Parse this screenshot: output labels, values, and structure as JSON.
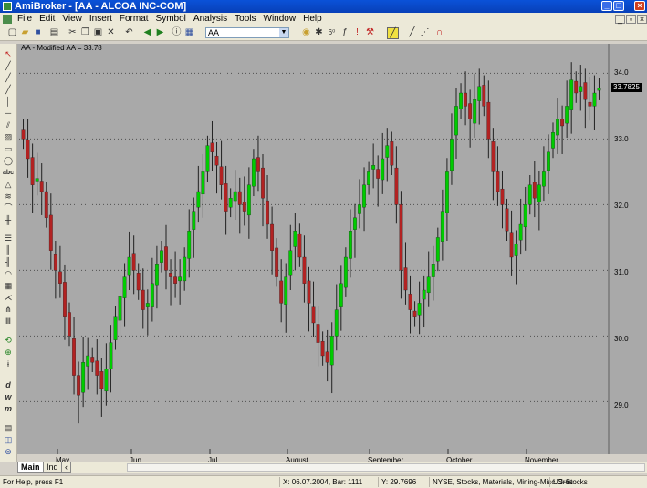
{
  "window": {
    "title": "AmiBroker - [AA - ALCOA INC-COM]"
  },
  "menu": {
    "items": [
      "File",
      "Edit",
      "View",
      "Insert",
      "Format",
      "Symbol",
      "Analysis",
      "Tools",
      "Window",
      "Help"
    ]
  },
  "toolbar": {
    "symbol_value": "AA"
  },
  "chart": {
    "header": "AA - Modified AA = 33.78",
    "last_price_label": "33.7825"
  },
  "chart_data": {
    "type": "candlestick",
    "title": "AA - Modified AA = 33.78",
    "ylim": [
      28.2,
      34.45
    ],
    "y_ticks": [
      "34.0",
      "33.0",
      "32.0",
      "31.0",
      "30.0",
      "29.0"
    ],
    "x_ticks": [
      "May",
      "Jun",
      "Jul",
      "August",
      "September",
      "October",
      "November"
    ],
    "grid": true,
    "up_color": "#00cc00",
    "down_color": "#b22222",
    "last_value": 33.7825,
    "closes": [
      33.0,
      32.7,
      32.3,
      32.4,
      32.2,
      31.8,
      31.3,
      31.0,
      30.8,
      30.3,
      30.0,
      29.4,
      29.1,
      29.6,
      29.7,
      29.6,
      29.4,
      29.2,
      29.5,
      29.9,
      30.3,
      30.6,
      30.9,
      31.2,
      31.0,
      30.7,
      30.4,
      30.5,
      30.8,
      31.1,
      31.3,
      31.0,
      30.9,
      30.8,
      30.9,
      31.2,
      31.6,
      31.9,
      32.2,
      32.5,
      32.9,
      32.8,
      32.6,
      32.3,
      31.9,
      32.1,
      32.2,
      32.0,
      31.9,
      32.3,
      32.7,
      32.5,
      32.1,
      31.7,
      31.3,
      30.9,
      30.5,
      30.9,
      31.3,
      31.6,
      31.2,
      30.8,
      30.5,
      30.2,
      29.9,
      29.7,
      29.6,
      30.0,
      30.4,
      30.8,
      31.2,
      31.6,
      31.8,
      32.0,
      32.3,
      32.5,
      32.6,
      32.4,
      32.7,
      32.9,
      32.6,
      32.0,
      31.0,
      30.7,
      30.4,
      30.3,
      30.5,
      30.7,
      30.9,
      31.1,
      31.5,
      31.9,
      32.5,
      33.0,
      33.5,
      33.7,
      33.5,
      33.3,
      33.6,
      33.8,
      33.5,
      33.0,
      32.5,
      32.2,
      32.0,
      31.6,
      31.2,
      31.4,
      31.7,
      32.0,
      32.3,
      32.1,
      32.3,
      32.5,
      32.8,
      33.1,
      33.3,
      33.2,
      33.5,
      33.9,
      33.7,
      33.8,
      33.6,
      33.5,
      33.7,
      33.78
    ]
  },
  "tabs": [
    "Main",
    "Ind"
  ],
  "status": {
    "help": "For Help, press F1",
    "xinfo": "X: 06.07.2004, Bar: 1111",
    "yinfo": "Y: 29.7696",
    "market": "NYSE, Stocks, Materials, Mining-Misc Ores",
    "db": "US-Stocks"
  }
}
